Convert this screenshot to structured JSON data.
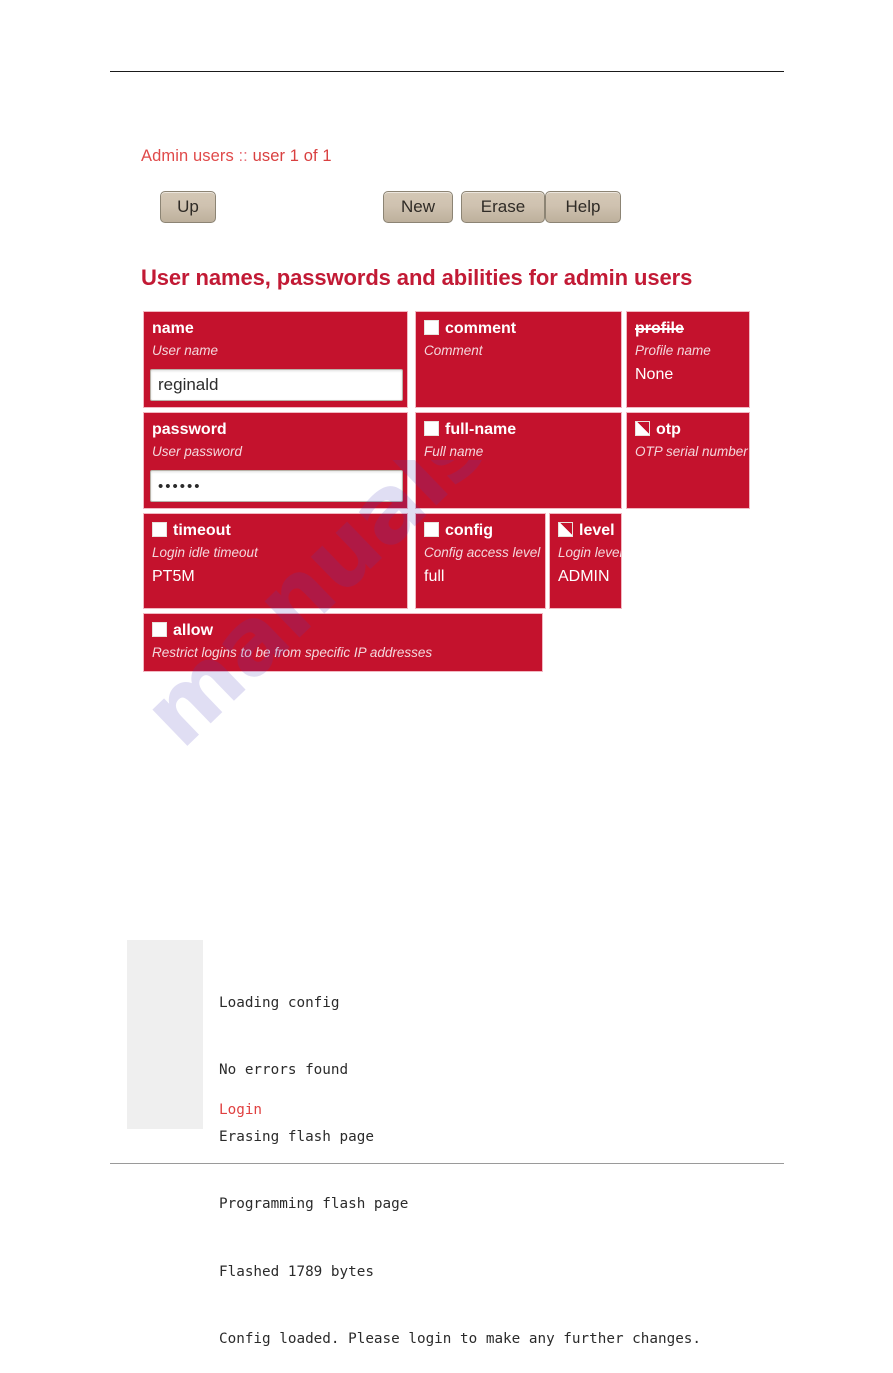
{
  "colors": {
    "accent_red": "#C4122D",
    "heading_red": "#C21A35",
    "breadcrumb_red": "#E04A4A",
    "button_face": "#CFC2B0",
    "log_gutter_gray": "#EFEFEF",
    "watermark_violet": "#4B3FBE"
  },
  "breadcrumb": {
    "section": "Admin users",
    "separator": "::",
    "position": "user 1 of 1"
  },
  "toolbar": {
    "up_label": "Up",
    "new_label": "New",
    "erase_label": "Erase",
    "help_label": "Help"
  },
  "heading": "User names, passwords and abilities for admin users",
  "form": {
    "fields": [
      {
        "name": "name",
        "label": "name",
        "description": "User name",
        "value": "reginald",
        "input_type": "text",
        "has_checkbox": false,
        "checkbox_state": "none",
        "struck": false
      },
      {
        "name": "comment",
        "label": "comment",
        "description": "Comment",
        "value": "",
        "input_type": "none",
        "has_checkbox": true,
        "checkbox_state": "unchecked",
        "struck": false
      },
      {
        "name": "profile",
        "label": "profile",
        "description": "Profile name",
        "value": "None",
        "input_type": "none",
        "has_checkbox": false,
        "checkbox_state": "none",
        "struck": true
      },
      {
        "name": "password",
        "label": "password",
        "description": "User password",
        "value": "••••••",
        "input_type": "password",
        "has_checkbox": false,
        "checkbox_state": "none",
        "struck": false
      },
      {
        "name": "full-name",
        "label": "full-name",
        "description": "Full name",
        "value": "",
        "input_type": "none",
        "has_checkbox": true,
        "checkbox_state": "unchecked",
        "struck": false
      },
      {
        "name": "otp",
        "label": "otp",
        "description": "OTP serial number",
        "value": "",
        "input_type": "none",
        "has_checkbox": true,
        "checkbox_state": "marked",
        "struck": false
      },
      {
        "name": "timeout",
        "label": "timeout",
        "description": "Login idle timeout",
        "value": "PT5M",
        "input_type": "none",
        "has_checkbox": true,
        "checkbox_state": "unchecked",
        "struck": false
      },
      {
        "name": "config",
        "label": "config",
        "description": "Config access level",
        "value": "full",
        "input_type": "none",
        "has_checkbox": true,
        "checkbox_state": "unchecked",
        "struck": false
      },
      {
        "name": "level",
        "label": "level",
        "description": "Login level",
        "value": "ADMIN",
        "input_type": "none",
        "has_checkbox": true,
        "checkbox_state": "marked",
        "struck": false
      },
      {
        "name": "allow",
        "label": "allow",
        "description": "Restrict logins to be from specific IP addresses",
        "value": "",
        "input_type": "none",
        "has_checkbox": true,
        "checkbox_state": "unchecked",
        "struck": false
      }
    ]
  },
  "log": {
    "lines": [
      "Loading config",
      "No errors found",
      "Erasing flash page",
      "Programming flash page",
      "Flashed 1789 bytes",
      "Config loaded. Please login to make any further changes."
    ],
    "link_label": "Login"
  },
  "watermark": {
    "text": "manualshive.com"
  }
}
